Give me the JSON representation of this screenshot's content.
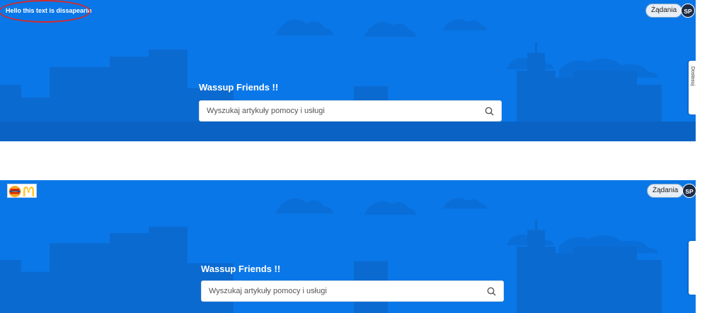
{
  "screen_top": {
    "annotation_text": "Hello this text is dissapearin",
    "requests_label": "Żądania",
    "avatar_initials": "SP",
    "title": "Wassup Friends !!",
    "search_placeholder": "Wyszukaj artykuły pomocy i usługi",
    "side_tab_label": "Dostosuj"
  },
  "screen_bottom": {
    "logo_icons": [
      "burger-king-logo-icon",
      "mcdonalds-logo-icon"
    ],
    "requests_label": "Żądania",
    "avatar_initials": "SP",
    "title": "Wassup Friends !!",
    "search_placeholder": "Wyszukaj artykuły pomocy i usługi"
  },
  "colors": {
    "banner_blue": "#0a77e8",
    "annotation_red": "#d42a2a",
    "avatar_dark": "#1c2c44"
  }
}
